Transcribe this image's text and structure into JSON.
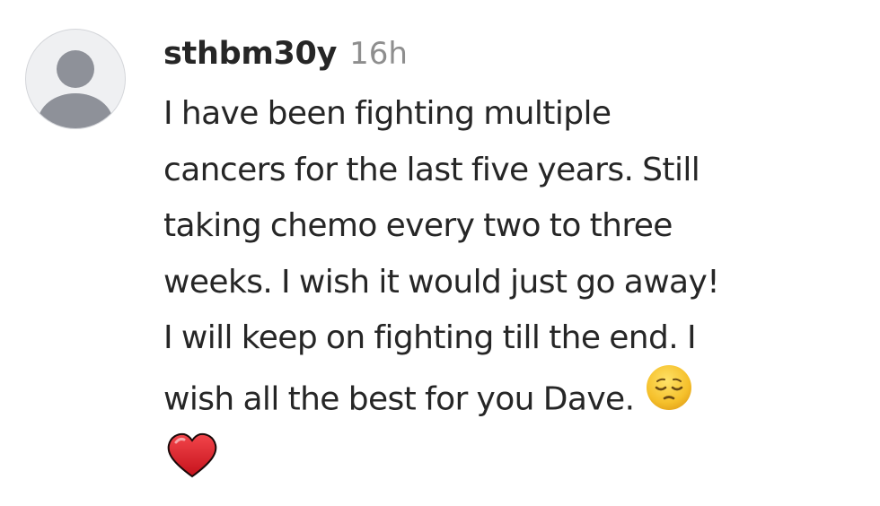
{
  "comment": {
    "username": "sthbm30y",
    "timestamp": "16h",
    "lines": [
      "I have been fighting multiple",
      "cancers for the last five years. Still",
      "taking chemo every two to three",
      "weeks. I wish it would just go away!",
      "I will keep on fighting till the end. I",
      "wish all the best for you Dave."
    ],
    "emojis": [
      "pensive-face-icon",
      "red-heart-icon"
    ]
  },
  "colors": {
    "avatar_bg": "#eff0f2",
    "avatar_silhouette": "#8e9199",
    "text": "#262626",
    "timestamp": "#8e8e8e",
    "emoji_yellow": "#f5c02b",
    "heart_red": "#dd1f26"
  }
}
